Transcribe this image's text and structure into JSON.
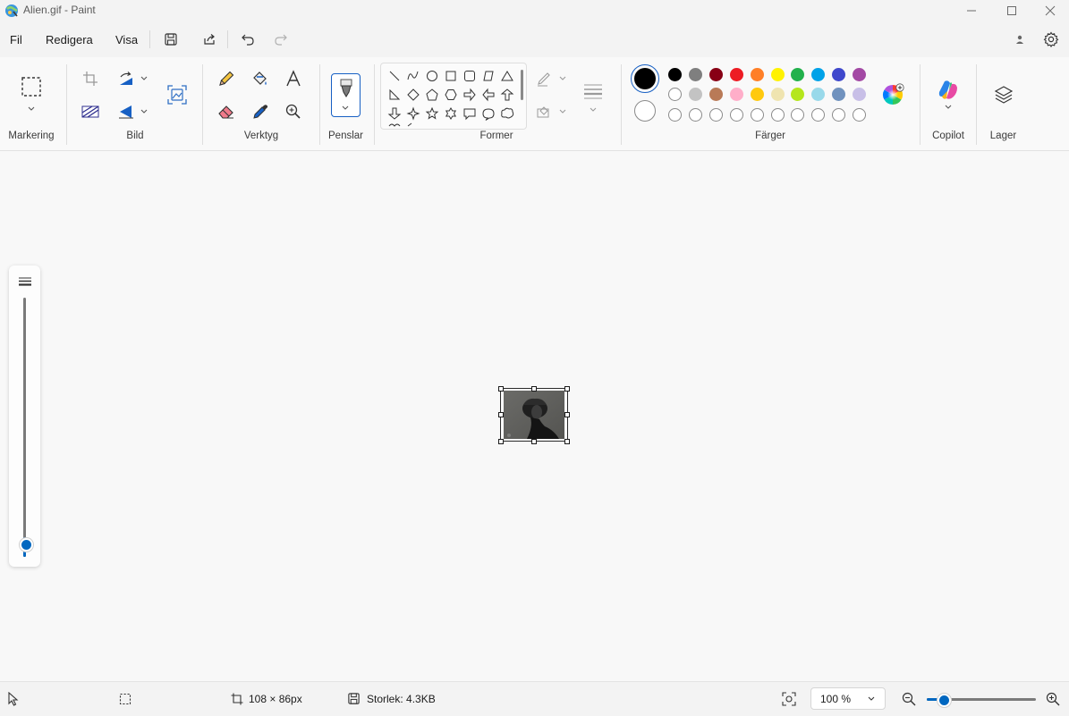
{
  "window": {
    "title": "Alien.gif - Paint"
  },
  "menu": {
    "file": "Fil",
    "edit": "Redigera",
    "view": "Visa"
  },
  "ribbon": {
    "groups": {
      "selection": "Markering",
      "image": "Bild",
      "tools": "Verktyg",
      "brushes": "Penslar",
      "shapes": "Former",
      "colors": "Färger",
      "copilot": "Copilot",
      "layers": "Lager"
    },
    "shape_icons": [
      "line-shape-icon",
      "curve-shape-icon",
      "oval-shape-icon",
      "rectangle-shape-icon",
      "rounded-rectangle-shape-icon",
      "polygon-shape-icon",
      "triangle-shape-icon",
      "right-triangle-shape-icon",
      "diamond-shape-icon",
      "pentagon-shape-icon",
      "hexagon-shape-icon",
      "right-arrow-shape-icon",
      "left-arrow-shape-icon",
      "up-arrow-shape-icon",
      "down-arrow-shape-icon",
      "four-point-star-shape-icon",
      "five-point-star-shape-icon",
      "six-point-star-shape-icon",
      "rect-callout-shape-icon",
      "oval-callout-shape-icon",
      "cloud-callout-shape-icon"
    ],
    "colors": {
      "primary": "#000000",
      "secondary": "#ffffff",
      "row1": [
        "#000000",
        "#7f7f7f",
        "#880015",
        "#ed1c24",
        "#ff7f27",
        "#fff200",
        "#22b14c",
        "#00a2e8",
        "#3f48cc",
        "#a349a4"
      ],
      "row2": [
        "#ffffff",
        "#c3c3c3",
        "#b97a57",
        "#ffaec9",
        "#ffc90e",
        "#efe4b0",
        "#b5e61d",
        "#99d9ea",
        "#7092be",
        "#c8bfe7"
      ]
    }
  },
  "status": {
    "selection_size": "108 × 86px",
    "file_size": "Storlek: 4.3KB",
    "zoom": "100 %"
  },
  "accent": "#0067c0"
}
